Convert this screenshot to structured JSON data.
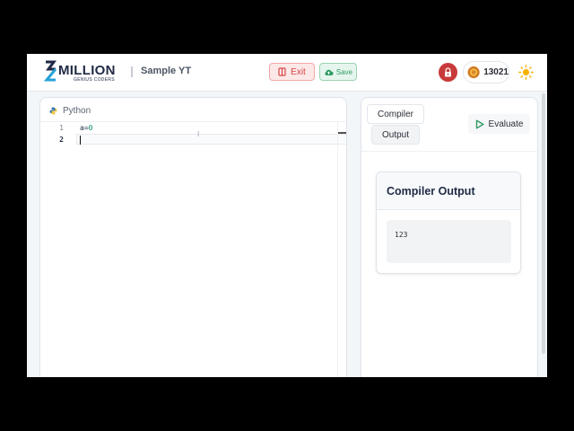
{
  "header": {
    "logo_text": "MILLION",
    "logo_subtext": "GENIUS CODERS",
    "project_title": "Sample YT",
    "exit_label": "Exit",
    "save_label": "Save",
    "coins": "13021",
    "icons": {
      "exit": "exit-door-icon",
      "save": "cloud-upload-icon",
      "lock": "lock-icon",
      "coin": "coin-icon",
      "theme": "sun-icon"
    }
  },
  "editor": {
    "language": "Python",
    "lines": [
      {
        "number": "1",
        "var": "a=",
        "num": "0"
      },
      {
        "number": "2",
        "text": ""
      }
    ]
  },
  "output_panel": {
    "tab_compiler": "Compiler",
    "tab_output": "Output",
    "evaluate_label": "Evaluate",
    "card_title": "Compiler Output",
    "output_text": "123"
  },
  "colors": {
    "exit": "#d64545",
    "save": "#2f9b63",
    "lock_badge": "#c83a3a",
    "evaluate_icon": "#2f9b63",
    "sun": "#f5b400"
  }
}
